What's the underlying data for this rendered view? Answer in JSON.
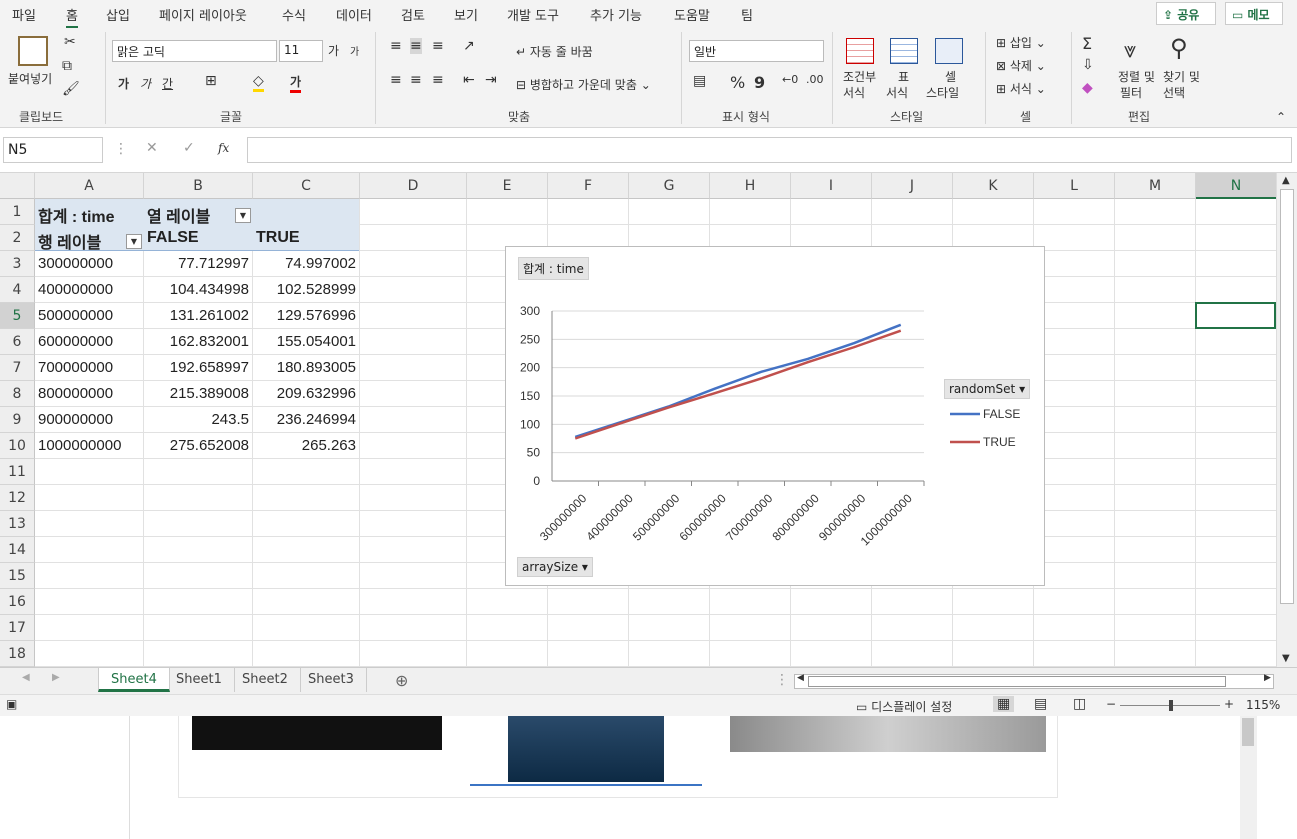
{
  "menu": {
    "items": [
      "파일",
      "홈",
      "삽입",
      "페이지 레이아웃",
      "수식",
      "데이터",
      "검토",
      "보기",
      "개발 도구",
      "추가 기능",
      "도움말",
      "팀"
    ],
    "share": "공유",
    "memo": "메모"
  },
  "ribbon": {
    "clipboard": {
      "paste": "붙여넣기",
      "label": "클립보드"
    },
    "font": {
      "name": "맑은 고딕",
      "size": "11",
      "label": "글꼴",
      "inc": "가",
      "dec": "가",
      "bold": "가",
      "italic": "가",
      "underline": "간",
      "color_letter": "가"
    },
    "align": {
      "wrap": "자동 줄 바꿈",
      "merge": "병합하고 가운데 맞춤",
      "label": "맞춤"
    },
    "number": {
      "format": "일반",
      "label": "표시 형식",
      "percent": "%",
      "comma": "9"
    },
    "styles": {
      "cond": "조건부",
      "cond2": "서식",
      "table": "표",
      "table2": "서식",
      "cell": "셀",
      "cell2": "스타일",
      "label": "스타일"
    },
    "cells": {
      "insert": "삽입",
      "delete": "삭제",
      "format": "서식",
      "label": "셀"
    },
    "edit": {
      "sort": "정렬 및",
      "sort2": "필터",
      "find": "찾기 및",
      "find2": "선택",
      "label": "편집"
    }
  },
  "formula_bar": {
    "name_box": "N5",
    "fx": "fx",
    "value": ""
  },
  "columns": [
    "A",
    "B",
    "C",
    "D",
    "E",
    "F",
    "G",
    "H",
    "I",
    "J",
    "K",
    "L",
    "M",
    "N"
  ],
  "rows": [
    "1",
    "2",
    "3",
    "4",
    "5",
    "6",
    "7",
    "8",
    "9",
    "10",
    "11",
    "12",
    "13",
    "14",
    "15",
    "16",
    "17",
    "18"
  ],
  "pivot": {
    "title": "합계 : time",
    "col_label": "열 레이블",
    "row_label": "행 레이블",
    "headers": [
      "FALSE",
      "TRUE"
    ],
    "data": [
      [
        "300000000",
        "77.712997",
        "74.997002"
      ],
      [
        "400000000",
        "104.434998",
        "102.528999"
      ],
      [
        "500000000",
        "131.261002",
        "129.576996"
      ],
      [
        "600000000",
        "162.832001",
        "155.054001"
      ],
      [
        "700000000",
        "192.658997",
        "180.893005"
      ],
      [
        "800000000",
        "215.389008",
        "209.632996"
      ],
      [
        "900000000",
        "243.5",
        "236.246994"
      ],
      [
        "1000000000",
        "275.652008",
        "265.263"
      ]
    ]
  },
  "chart_data": {
    "type": "line",
    "title": "합계 : time",
    "categories": [
      "300000000",
      "400000000",
      "500000000",
      "600000000",
      "700000000",
      "800000000",
      "900000000",
      "1000000000"
    ],
    "series": [
      {
        "name": "FALSE",
        "color": "#4472c4",
        "values": [
          77.712997,
          104.434998,
          131.261002,
          162.832001,
          192.658997,
          215.389008,
          243.5,
          275.652008
        ]
      },
      {
        "name": "TRUE",
        "color": "#c0504d",
        "values": [
          74.997002,
          102.528999,
          129.576996,
          155.054001,
          180.893005,
          209.632996,
          236.246994,
          265.263
        ]
      }
    ],
    "ylim": [
      0,
      300
    ],
    "yticks": [
      "0",
      "50",
      "100",
      "150",
      "200",
      "250",
      "300"
    ],
    "legend_title": "randomSet",
    "axis_button": "arraySize",
    "grid": true,
    "legend_position": "right"
  },
  "sheets": {
    "tabs": [
      "Sheet4",
      "Sheet1",
      "Sheet2",
      "Sheet3"
    ],
    "active": "Sheet4"
  },
  "status": {
    "display": "디스플레이 설정",
    "zoom": "115%"
  },
  "colors": {
    "accent": "#217346",
    "series_false": "#4472c4",
    "series_true": "#c0504d"
  }
}
